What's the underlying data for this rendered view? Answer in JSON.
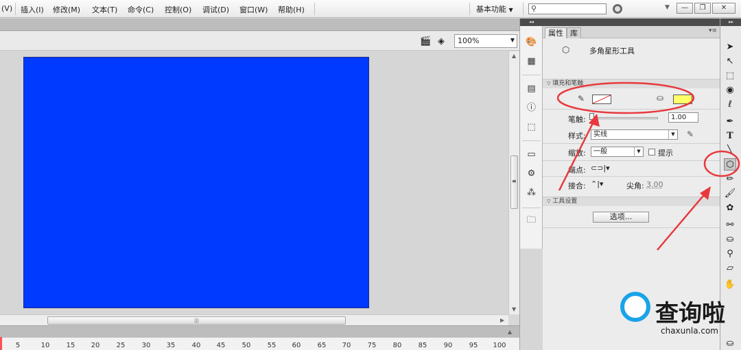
{
  "menubar": {
    "items": [
      "(V)",
      "插入(I)",
      "修改(M)",
      "文本(T)",
      "命令(C)",
      "控制(O)",
      "调试(D)",
      "窗口(W)",
      "帮助(H)"
    ],
    "workspace_label": "基本功能",
    "search_placeholder": "",
    "window_min": "—",
    "window_restore": "❐",
    "window_close": "✕"
  },
  "stage": {
    "zoom_value": "100%",
    "stage_color": "#0039ff",
    "hscroll_grip": "|||",
    "vscroll_grip": "≡"
  },
  "timeline": {
    "ruler": [
      "5",
      "10",
      "15",
      "20",
      "25",
      "30",
      "35",
      "40",
      "45",
      "50",
      "55",
      "60",
      "65",
      "70",
      "75",
      "80",
      "85",
      "90",
      "95",
      "100"
    ]
  },
  "properties": {
    "tabs": [
      "属性",
      "库"
    ],
    "tool_name": "多角星形工具",
    "section_fill_stroke": "填充和笔触",
    "stroke_width_label": "笔触:",
    "stroke_width_value": "1.00",
    "style_label": "样式:",
    "style_value": "实线",
    "scale_label": "缩放:",
    "scale_value": "一般",
    "hint_label": "提示",
    "cap_label": "端点:",
    "join_label": "接合:",
    "miter_label": "尖角:",
    "miter_value": "3.00",
    "section_tool_settings": "工具设置",
    "options_button": "选项...",
    "fill_color": "#ffff66",
    "stroke_color": "none"
  },
  "annotation_color": "#e8383d",
  "watermark": {
    "brand": "查询啦",
    "url": "chaxunla.com"
  }
}
